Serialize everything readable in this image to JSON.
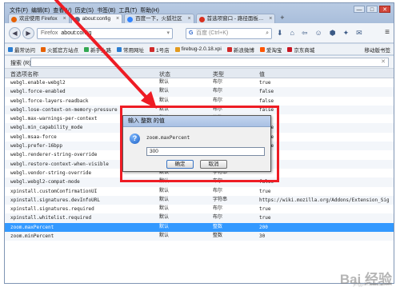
{
  "menubar": [
    "文件(F)",
    "编辑(E)",
    "查看(V)",
    "历史(S)",
    "书签(B)",
    "工具(T)",
    "帮助(H)"
  ],
  "window_controls": [
    "—",
    "□",
    "✕"
  ],
  "tabs": [
    {
      "label": "欢迎使用 Firefox",
      "favicon_color": "#e66000",
      "active": false
    },
    {
      "label": "about:config",
      "favicon_color": "#5a6b86",
      "active": true
    },
    {
      "label": "百度一下，火狐社区",
      "favicon_color": "#3385ff",
      "active": false
    },
    {
      "label": "首选项窗口 - 路径面板…",
      "favicon_color": "#d9301e",
      "active": false
    }
  ],
  "new_tab_label": "+",
  "nav": {
    "back": "◀",
    "forward": "▶",
    "url_proto": "Firefox",
    "url": "about:config",
    "search_placeholder": "百度 (Ctrl+K)",
    "search_engine_glyph": "G",
    "tool_icons": [
      "⬇",
      "⌂",
      "⇦",
      "☺",
      "⬢",
      "✦",
      "✉"
    ],
    "menu_glyph": "≡"
  },
  "bookmarks": [
    {
      "label": "最常访问",
      "color": "#2a7dd1"
    },
    {
      "label": "火狐官方站点",
      "color": "#e66000"
    },
    {
      "label": "新手上路",
      "color": "#32a852"
    },
    {
      "label": "常用网址",
      "color": "#2a7dd1"
    },
    {
      "label": "1号店",
      "color": "#d12a2a"
    },
    {
      "label": "firebug-2.0.18.xpi",
      "color": "#e29a1d"
    },
    {
      "label": "新浪微博",
      "color": "#d12a2a"
    },
    {
      "label": "爱淘宝",
      "color": "#ff5500"
    },
    {
      "label": "京东商城",
      "color": "#c81623"
    }
  ],
  "bookmarks_right": "移动版书签",
  "filter": {
    "label": "搜索 (R):",
    "value": ""
  },
  "columns": {
    "name": "首选项名称",
    "state": "状态",
    "type": "类型",
    "value": "值"
  },
  "rows": [
    {
      "name": "webgl.enable-webgl2",
      "state": "默认",
      "type": "布尔",
      "value": "true"
    },
    {
      "name": "webgl.force-enabled",
      "state": "默认",
      "type": "布尔",
      "value": "false"
    },
    {
      "name": "webgl.force-layers-readback",
      "state": "默认",
      "type": "布尔",
      "value": "false"
    },
    {
      "name": "webgl.lose-context-on-memory-pressure",
      "state": "默认",
      "type": "布尔",
      "value": "false"
    },
    {
      "name": "webgl.max-warnings-per-context",
      "state": "默认",
      "type": "整数",
      "value": "32"
    },
    {
      "name": "webgl.min_capability_mode",
      "state": "默认",
      "type": "布尔",
      "value": "false"
    },
    {
      "name": "webgl.msaa-force",
      "state": "默认",
      "type": "布尔",
      "value": "false"
    },
    {
      "name": "webgl.prefer-16bpp",
      "state": "默认",
      "type": "布尔",
      "value": "false"
    },
    {
      "name": "webgl.renderer-string-override",
      "state": "默认",
      "type": "字符串",
      "value": ""
    },
    {
      "name": "webgl.restore-context-when-visible",
      "state": "默认",
      "type": "布尔",
      "value": "true"
    },
    {
      "name": "webgl.vendor-string-override",
      "state": "默认",
      "type": "字符串",
      "value": ""
    },
    {
      "name": "webgl.webgl2-compat-mode",
      "state": "默认",
      "type": "布尔",
      "value": "false"
    },
    {
      "name": "xpinstall.customConfirmationUI",
      "state": "默认",
      "type": "布尔",
      "value": "true"
    },
    {
      "name": "xpinstall.signatures.devInfoURL",
      "state": "默认",
      "type": "字符串",
      "value": "https://wiki.mozilla.org/Addons/Extension_Sign…"
    },
    {
      "name": "xpinstall.signatures.required",
      "state": "默认",
      "type": "布尔",
      "value": "true"
    },
    {
      "name": "xpinstall.whitelist.required",
      "state": "默认",
      "type": "布尔",
      "value": "true"
    },
    {
      "name": "zoom.maxPercent",
      "state": "默认",
      "type": "整数",
      "value": "200",
      "selected": true
    },
    {
      "name": "zoom.minPercent",
      "state": "默认",
      "type": "整数",
      "value": "30"
    }
  ],
  "dialog": {
    "title": "输入 整数 的值",
    "prompt": "zoom.maxPercent",
    "value": "300",
    "ok_label": "确定",
    "cancel_label": "取消"
  },
  "annotation_color": "#ee1c24",
  "watermark": {
    "main": "Bai 经验",
    "sub": "jingyan.baidu.com"
  }
}
